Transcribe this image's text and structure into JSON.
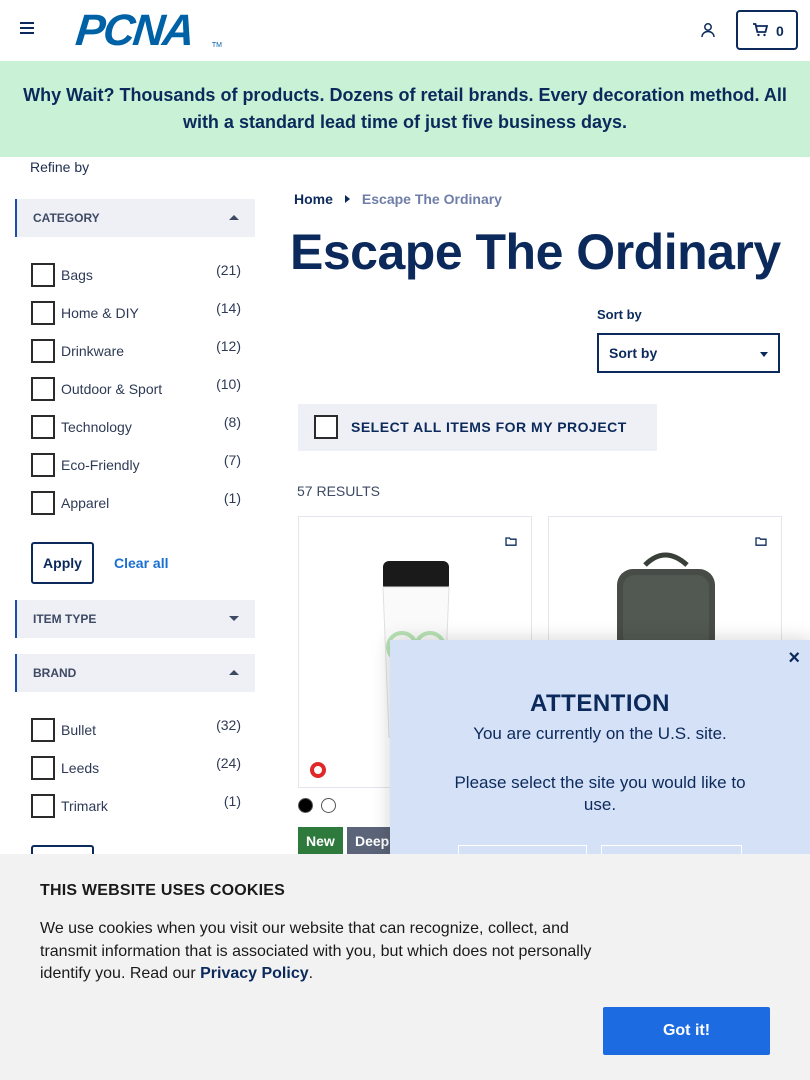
{
  "header": {
    "logo_text": "PCNA",
    "logo_tm": "TM",
    "cart_count": "0"
  },
  "promo": {
    "text": "Why Wait? Thousands of products. Dozens of retail brands. Every decoration method. All with a standard lead time of just five business days."
  },
  "sidebar": {
    "refine_label": "Refine by",
    "category": {
      "title": "CATEGORY",
      "items": [
        {
          "label": "Bags",
          "count": "(21)"
        },
        {
          "label": "Home & DIY",
          "count": "(14)"
        },
        {
          "label": "Drinkware",
          "count": "(12)"
        },
        {
          "label": "Outdoor & Sport",
          "count": "(10)"
        },
        {
          "label": "Technology",
          "count": "(8)"
        },
        {
          "label": "Eco-Friendly",
          "count": "(7)"
        },
        {
          "label": "Apparel",
          "count": "(1)"
        }
      ],
      "apply_label": "Apply",
      "clear_label": "Clear all"
    },
    "item_type": {
      "title": "ITEM TYPE"
    },
    "brand": {
      "title": "BRAND",
      "items": [
        {
          "label": "Bullet",
          "count": "(32)"
        },
        {
          "label": "Leeds",
          "count": "(24)"
        },
        {
          "label": "Trimark",
          "count": "(1)"
        }
      ]
    }
  },
  "main": {
    "breadcrumb": {
      "home": "Home",
      "current": "Escape The Ordinary"
    },
    "title": "Escape The Ordinary",
    "sort_label": "Sort by",
    "sort_value": "Sort by",
    "select_all_label": "SELECT ALL ITEMS FOR MY PROJECT",
    "results": "57 RESULTS",
    "product1": {
      "swatch_colors": [
        "#000000",
        "#ffffff"
      ],
      "badges": [
        "New",
        "Deep"
      ]
    }
  },
  "modal": {
    "close": "×",
    "title": "ATTENTION",
    "line1": "You are currently on the U.S. site.",
    "line2": "Please select the site you would like to use."
  },
  "cookie": {
    "title": "THIS WEBSITE USES COOKIES",
    "body": "We use cookies when you visit our website that can recognize, collect, and transmit information that is associated with you, but which does not personally identify you. Read our ",
    "link": "Privacy Policy",
    "period": ".",
    "button": "Got it!"
  },
  "colors": {
    "navy": "#0b2a5b",
    "promo_bg": "#c9f1d6",
    "modal_bg": "#d5e1f7",
    "cookie_btn": "#1d6be0",
    "badge_new": "#2d7a3c"
  }
}
